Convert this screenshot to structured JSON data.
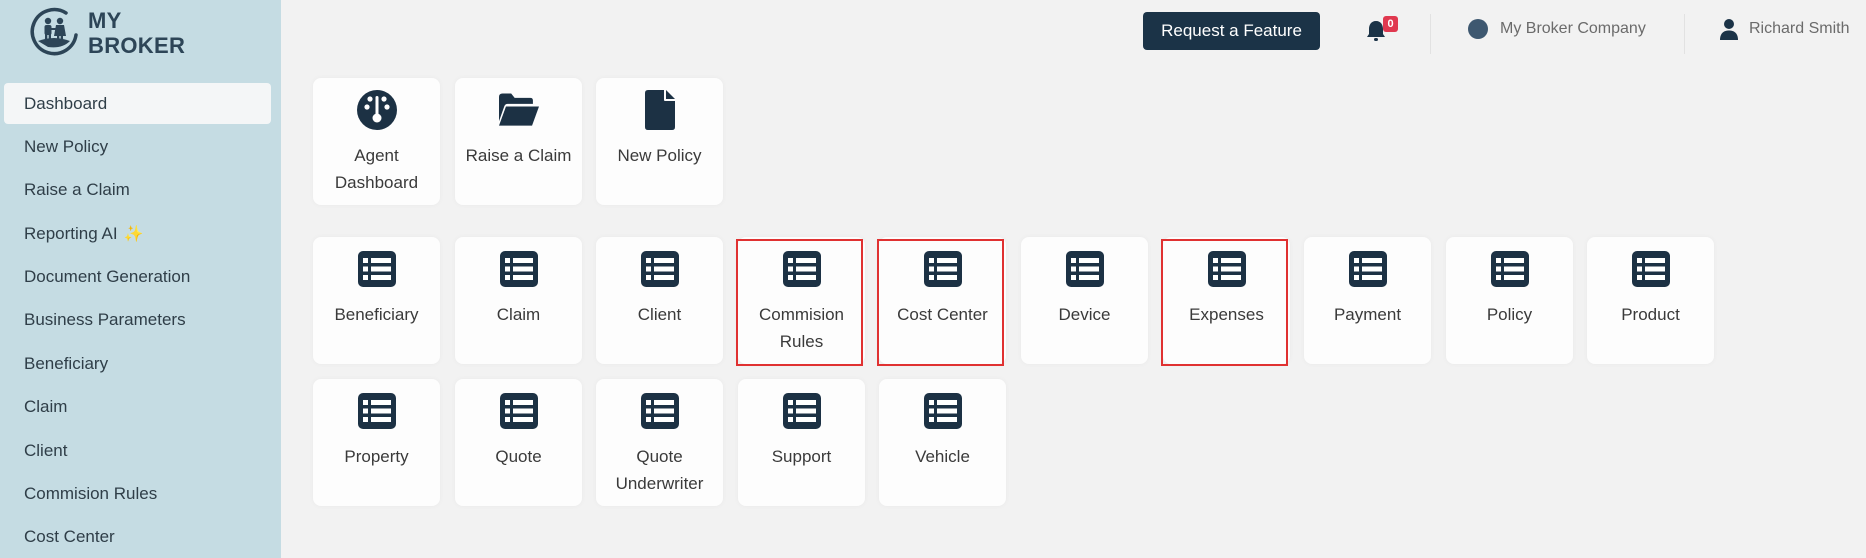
{
  "brand": {
    "line1": "MY",
    "line2": "BROKER"
  },
  "sidebar": {
    "items": [
      {
        "label": "Dashboard",
        "active": true
      },
      {
        "label": "New Policy"
      },
      {
        "label": "Raise a Claim"
      },
      {
        "label": "Reporting AI",
        "badge_icon": "sparkle-icon"
      },
      {
        "label": "Document Generation"
      },
      {
        "label": "Business Parameters"
      },
      {
        "label": "Beneficiary"
      },
      {
        "label": "Claim"
      },
      {
        "label": "Client"
      },
      {
        "label": "Commision Rules"
      },
      {
        "label": "Cost Center"
      }
    ],
    "sparkle": "✨"
  },
  "header": {
    "request_feature_label": "Request a Feature",
    "notifications_count": "0",
    "company": "My Broker Company",
    "user": "Richard Smith"
  },
  "quick_tiles": [
    {
      "label": "Agent Dashboard",
      "icon": "gauge-icon"
    },
    {
      "label": "Raise a Claim",
      "icon": "folder-open-icon"
    },
    {
      "label": "New Policy",
      "icon": "file-icon"
    }
  ],
  "entity_tiles": [
    {
      "label": "Beneficiary",
      "icon": "list-icon"
    },
    {
      "label": "Claim",
      "icon": "list-icon"
    },
    {
      "label": "Client",
      "icon": "list-icon"
    },
    {
      "label": "Commision Rules",
      "icon": "list-icon",
      "highlighted": true
    },
    {
      "label": "Cost Center",
      "icon": "list-icon",
      "highlighted": true
    },
    {
      "label": "Device",
      "icon": "list-icon"
    },
    {
      "label": "Expenses",
      "icon": "list-icon",
      "highlighted": true
    },
    {
      "label": "Payment",
      "icon": "list-icon"
    },
    {
      "label": "Policy",
      "icon": "list-icon"
    },
    {
      "label": "Product",
      "icon": "list-icon"
    },
    {
      "label": "Property",
      "icon": "list-icon"
    },
    {
      "label": "Quote",
      "icon": "list-icon"
    },
    {
      "label": "Quote Underwriter",
      "icon": "list-icon"
    },
    {
      "label": "Support",
      "icon": "list-icon"
    },
    {
      "label": "Vehicle",
      "icon": "list-icon"
    }
  ],
  "colors": {
    "sidebar": "#c5dce3",
    "primary": "#1b3347",
    "badge": "#e0384f",
    "highlight": "#e03131"
  }
}
